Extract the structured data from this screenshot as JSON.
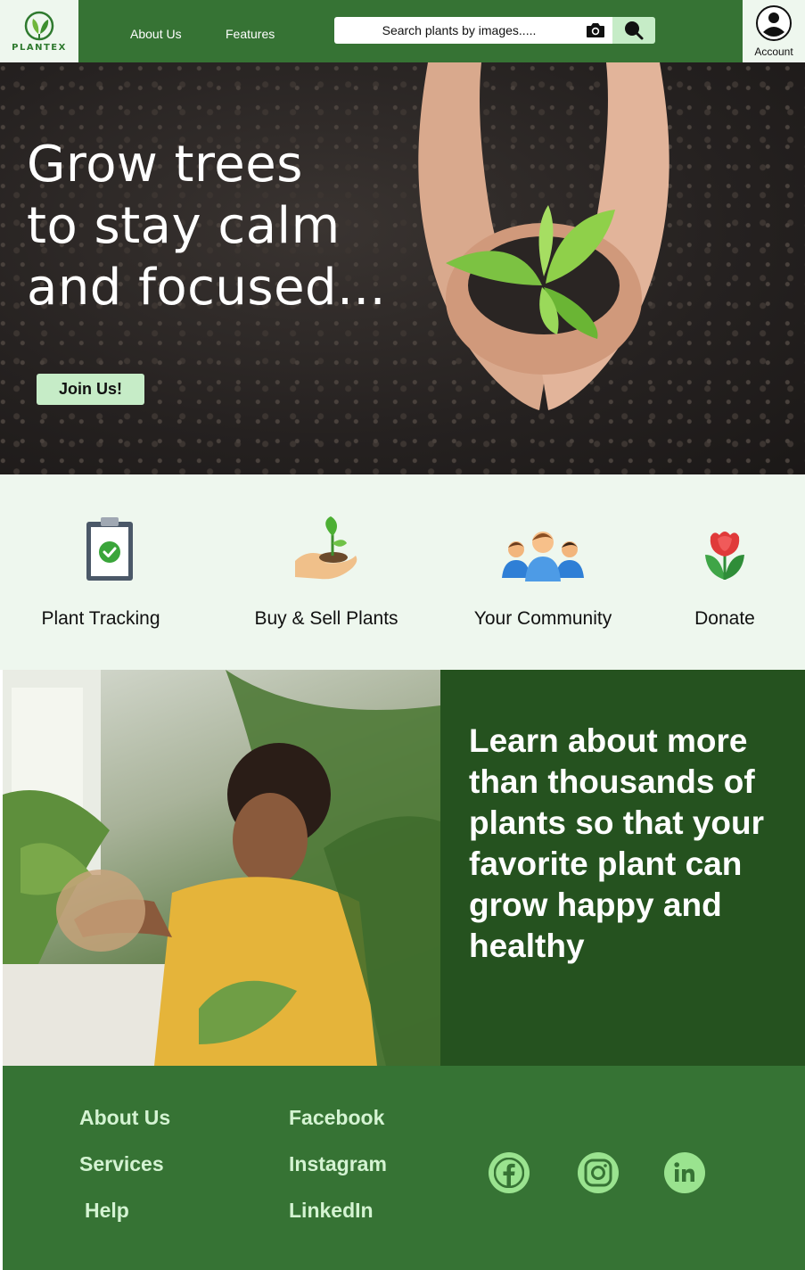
{
  "brand": {
    "name": "PLANTEX"
  },
  "nav": {
    "about": "About Us",
    "features": "Features"
  },
  "search": {
    "placeholder": "Search plants by images....."
  },
  "account": {
    "label": "Account"
  },
  "hero": {
    "title_lines": [
      "Grow trees",
      "to stay calm",
      "and focused..."
    ],
    "cta": "Join Us!"
  },
  "features": [
    {
      "label": "Plant Tracking",
      "icon": "clipboard-check-icon"
    },
    {
      "label": "Buy & Sell Plants",
      "icon": "hand-sprout-icon"
    },
    {
      "label": "Your Community",
      "icon": "people-group-icon"
    },
    {
      "label": "Donate",
      "icon": "flower-icon"
    }
  ],
  "learn": {
    "text": "Learn about more than thousands of plants so that your favorite plant can grow happy and healthy"
  },
  "footer": {
    "col1": [
      "About Us",
      "Services",
      "Help"
    ],
    "col2": [
      "Facebook",
      "Instagram",
      "LinkedIn"
    ],
    "social": [
      "facebook-icon",
      "instagram-icon",
      "linkedin-icon"
    ]
  },
  "colors": {
    "header_green": "#367334",
    "dark_green": "#25521f",
    "light_mint": "#eef7ee",
    "button_mint": "#c6ecc7",
    "social_green": "#9ae38f",
    "footer_text": "#d4f3d2"
  }
}
